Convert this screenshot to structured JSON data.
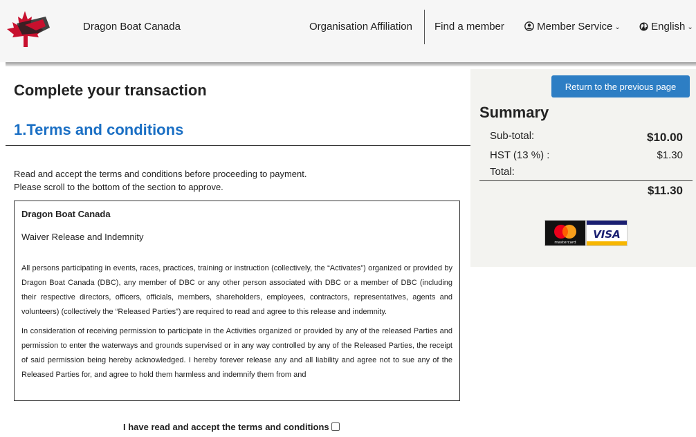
{
  "header": {
    "brand": "Dragon Boat Canada",
    "logo_icon": "maple-leaf-dragon-logo",
    "nav": {
      "organisation": "Organisation Affiliation",
      "find_member": "Find a member",
      "member_service": "Member Service",
      "language": "English"
    }
  },
  "main": {
    "page_title": "Complete your transaction",
    "section_title": "1.Terms and conditions",
    "instruction_line1": "Read and accept the terms and conditions before proceeding to payment.",
    "instruction_line2": "Please scroll to the bottom of the section to approve.",
    "terms": {
      "org": "Dragon Boat Canada",
      "subtitle": "Waiver Release and Indemnity",
      "para1": "All persons participating in events, races, practices, training or instruction (collectively, the “Activates”) organized or provided by Dragon Boat Canada (DBC), any member of DBC or any other person associated with DBC or a member of DBC (including their respective directors, officers, officials, members, shareholders, employees, contractors, representatives, agents and volunteers) (collectively the “Released Parties”) are required to read and agree to this release and indemnity.",
      "para2": "In consideration of receiving permission to participate in the Activities organized or provided by any of the released Parties and permission to enter the waterways and grounds supervised or in any way controlled by any of the Released Parties, the receipt of said permission being hereby acknowledged. I hereby forever release any and all liability and agree not to sue any of the Released Parties for, and agree to hold them harmless and indemnify them from and"
    },
    "accept_label": "I have read and accept the terms and conditions"
  },
  "summary": {
    "return_button": "Return to the previous page",
    "title": "Summary",
    "subtotal_label": "Sub-total:",
    "subtotal_value": "$10.00",
    "tax_label": "HST (13 %) :",
    "tax_value": "$1.30",
    "total_label": "Total:",
    "total_value": "$11.30",
    "card_brands": {
      "mastercard": "mastercard",
      "visa": "VISA"
    }
  },
  "colors": {
    "accent_blue": "#1a6fc4",
    "button_blue": "#2d7ec4",
    "logo_red": "#c8102e"
  }
}
